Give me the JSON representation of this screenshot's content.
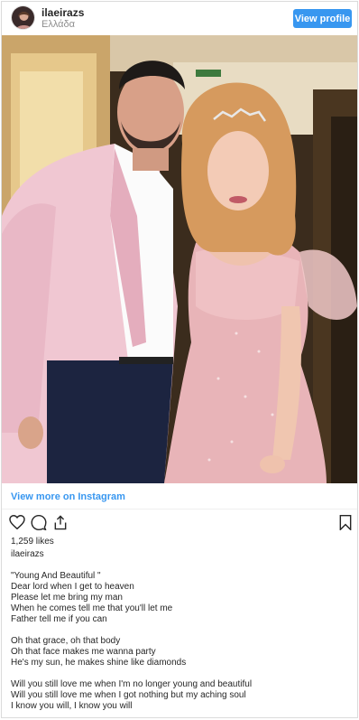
{
  "header": {
    "username": "ilaeirazs",
    "location": "Ελλάδα",
    "view_profile": "View profile"
  },
  "photo": {
    "description": "couple-photo"
  },
  "view_more": "View more on Instagram",
  "actions": {
    "like_icon": "heart-icon",
    "comment_icon": "comment-icon",
    "share_icon": "share-icon",
    "save_icon": "bookmark-icon"
  },
  "likes": "1,259 likes",
  "caption_username": "ilaeirazs",
  "caption": {
    "lines_1": [
      "\"Young And Beautiful \"",
      "Dear lord when I get to heaven",
      "Please let me bring my man",
      "When he comes tell me that you'll let me",
      "Father tell me if you can"
    ],
    "lines_2": [
      "Oh that grace, oh that body",
      "Oh that face makes me wanna party",
      "He's my sun, he makes shine like diamonds"
    ],
    "lines_3": [
      "Will you still love me when I'm no longer young and beautiful",
      "Will you still love me when I got nothing but my aching soul",
      "I know you will, I know you will"
    ]
  },
  "colors": {
    "accent": "#3897f0",
    "text": "#262626",
    "muted": "#8e8e8e"
  }
}
